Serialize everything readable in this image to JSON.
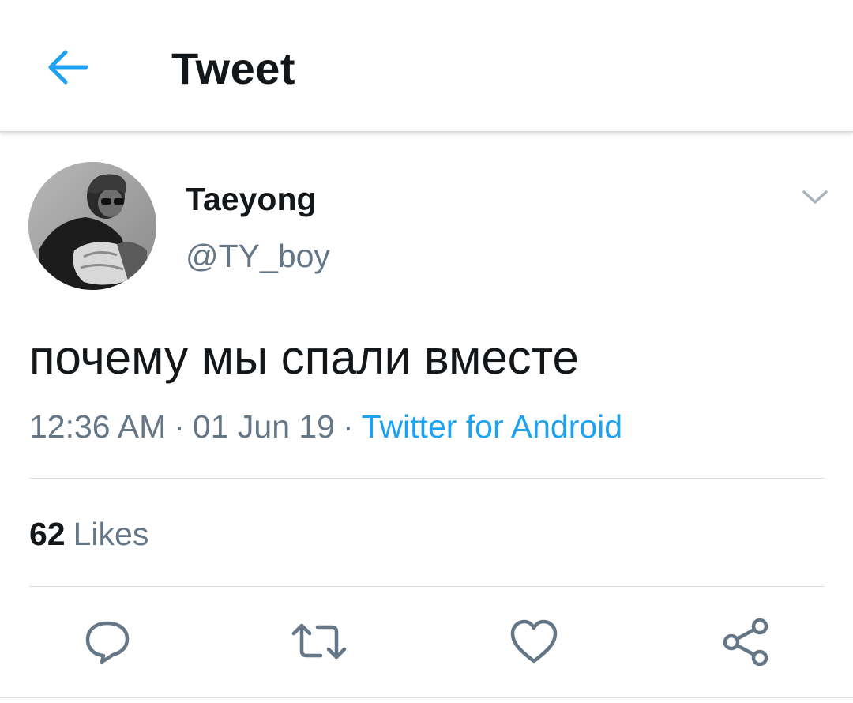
{
  "header": {
    "title": "Tweet",
    "back_icon": "arrow-left-icon"
  },
  "tweet": {
    "author": {
      "display_name": "Taeyong",
      "handle": "@TY_boy"
    },
    "text": "почему мы спали вместе",
    "time": "12:36 AM",
    "separator": "·",
    "date": "01 Jun 19",
    "source": "Twitter for Android",
    "likes_count": "62",
    "likes_label": "Likes"
  },
  "actions": {
    "icons": [
      "reply-icon",
      "retweet-icon",
      "like-icon",
      "share-icon"
    ]
  },
  "colors": {
    "accent": "#1da1f2",
    "secondary_text": "#657786",
    "primary_text": "#14171a",
    "icon_gray": "#657786"
  }
}
